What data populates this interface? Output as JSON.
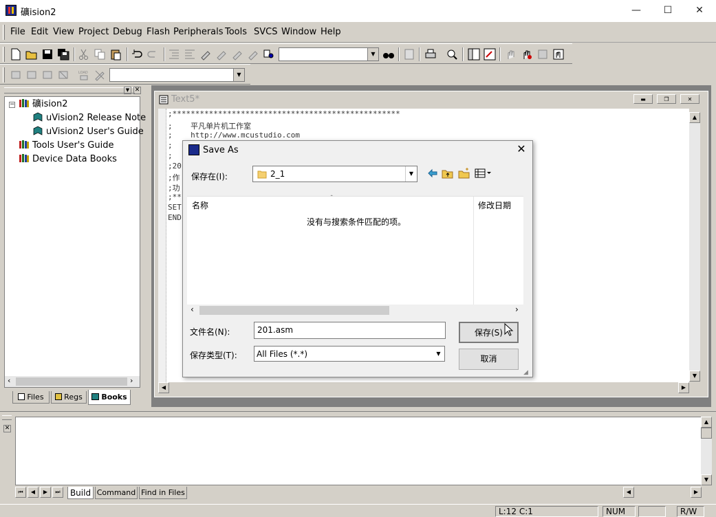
{
  "window": {
    "title": "礦ision2",
    "minimize": "—",
    "maximize": "☐",
    "close": "✕"
  },
  "menu": [
    "File",
    "Edit",
    "View",
    "Project",
    "Debug",
    "Flash",
    "Peripherals",
    "Tools",
    "SVCS",
    "Window",
    "Help"
  ],
  "tree": {
    "root": "礦ision2",
    "items": [
      "uVision2 Release Note",
      "uVision2 User's Guide",
      "Tools User's Guide",
      "Device Data Books"
    ]
  },
  "left_tabs": [
    "Files",
    "Regs",
    "Books"
  ],
  "editor": {
    "title": "Text5*",
    "lines": [
      ";**************************************************",
      ";    平凡单片机工作室",
      ";    http://www.mcustudio.com",
      ";",
      ";",
      ";20",
      ";作",
      ";功",
      ";**",
      "SET",
      "END"
    ]
  },
  "dialog": {
    "title": "Save As",
    "save_in_label": "保存在(I):",
    "save_in_value": "2_1",
    "col_name": "名称",
    "col_modified": "修改日期",
    "empty_message": "没有与搜索条件匹配的项。",
    "filename_label": "文件名(N):",
    "filename_value": "201.asm",
    "filetype_label": "保存类型(T):",
    "filetype_value": "All Files (*.*)",
    "save_button": "保存(S)",
    "cancel_button": "取消"
  },
  "output_tabs": [
    "Build",
    "Command",
    "Find in Files"
  ],
  "status": {
    "position": "L:12 C:1",
    "num": "NUM",
    "rw": "R/W"
  }
}
